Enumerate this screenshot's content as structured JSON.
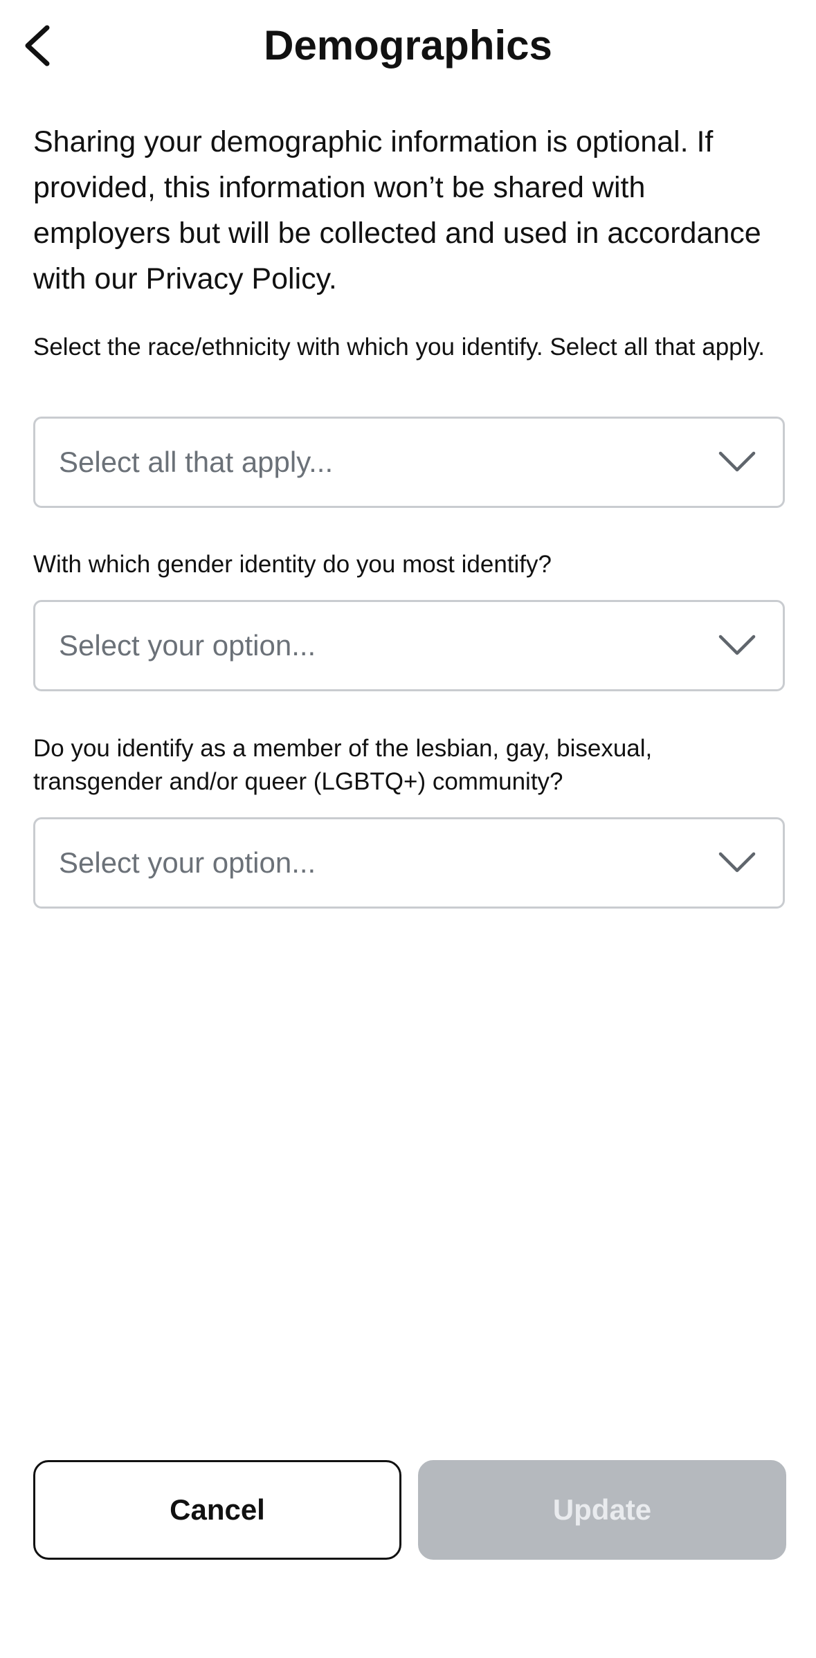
{
  "header": {
    "title": "Demographics",
    "back_icon": "chevron-left-icon"
  },
  "intro": {
    "text": "Sharing your demographic information is optional. If provided, this information won’t be shared with employers but will be collected and used in accordance with our Privacy Policy."
  },
  "fields": [
    {
      "label": "Select the race/ethnicity with which you identify. Select all that apply.",
      "placeholder": "Select all that apply...",
      "icon": "chevron-down-icon"
    },
    {
      "label": "With which gender identity do you most identify?",
      "placeholder": "Select your option...",
      "icon": "chevron-down-icon"
    },
    {
      "label": "Do you identify as a member of the lesbian, gay, bisexual, transgender and/or queer (LGBTQ+) community?",
      "placeholder": "Select your option...",
      "icon": "chevron-down-icon"
    }
  ],
  "footer": {
    "cancel_label": "Cancel",
    "update_label": "Update",
    "update_enabled": false
  },
  "colors": {
    "text": "#111111",
    "placeholder": "#6b7178",
    "border": "#c9ccd0",
    "disabled_button": "#b5b9be",
    "disabled_button_text": "#e9ebee"
  }
}
